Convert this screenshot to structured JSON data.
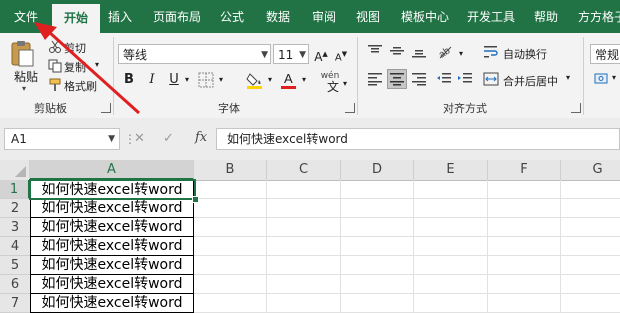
{
  "ribbon_tabs": [
    "文件",
    "开始",
    "插入",
    "页面布局",
    "公式",
    "数据",
    "审阅",
    "视图",
    "模板中心",
    "开发工具",
    "帮助",
    "方方格子"
  ],
  "clipboard": {
    "paste_label": "粘贴",
    "cut_label": "剪切",
    "copy_label": "复制",
    "format_painter_label": "格式刷",
    "group_label": "剪贴板"
  },
  "font": {
    "family": "等线",
    "size": "11",
    "bold": "B",
    "italic": "I",
    "underline": "U",
    "wen": "wén",
    "group_label": "字体"
  },
  "alignment": {
    "wrap_text_label": "自动换行",
    "merge_center_label": "合并后居中",
    "group_label": "对齐方式"
  },
  "number": {
    "format": "常规"
  },
  "formula_bar": {
    "name_box": "A1",
    "cancel": "✕",
    "enter": "✓",
    "fx": "fx",
    "content": "如何快速excel转word"
  },
  "grid": {
    "columns": [
      "A",
      "B",
      "C",
      "D",
      "E",
      "F",
      "G"
    ],
    "rows": [
      "1",
      "2",
      "3",
      "4",
      "5",
      "6",
      "7"
    ],
    "cells_A": [
      "如何快速excel转word",
      "如何快速excel转word",
      "如何快速excel转word",
      "如何快速excel转word",
      "如何快速excel转word",
      "如何快速excel转word",
      "如何快速excel转word"
    ]
  },
  "colors": {
    "excel_green": "#217346",
    "arrow_red": "#e02020",
    "font_color_red": "#e02020",
    "fill_yellow": "#ffd400"
  },
  "icons": [
    "paste-icon",
    "cut-icon",
    "copy-icon",
    "format-painter-icon",
    "fill-color-icon",
    "font-color-icon",
    "borders-icon",
    "wrap-text-icon",
    "merge-center-icon",
    "align-left-icon",
    "align-center-icon",
    "align-right-icon",
    "indent-icon",
    "fx-icon"
  ]
}
